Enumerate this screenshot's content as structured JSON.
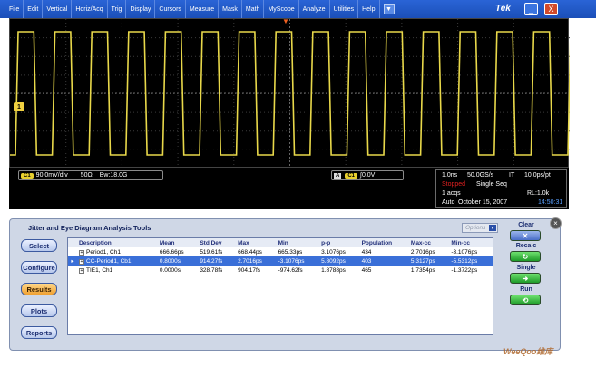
{
  "menubar": {
    "items": [
      "File",
      "Edit",
      "Vertical",
      "Horiz/Acq",
      "Trig",
      "Display",
      "Cursors",
      "Measure",
      "Mask",
      "Math",
      "MyScope",
      "Analyze",
      "Utilities",
      "Help"
    ],
    "logo": "Tek",
    "minimize_label": "_",
    "close_label": "X"
  },
  "waveform": {
    "channel_marker": "1",
    "color": "#e8d84a"
  },
  "readout": {
    "channel": {
      "badge": "C1",
      "scale": "90.0mV/div",
      "impedance": "50Ω",
      "bandwidth": "Bw:18.0G"
    },
    "trigger": {
      "source_a": "A",
      "badge": "C1",
      "level": "0.0V"
    },
    "acq": {
      "timebase": "1.0ns",
      "sample_rate": "50.0GS/s",
      "mode": "IT",
      "resolution": "10.0ps/pt",
      "state": "Stopped",
      "seq": "Single Seq",
      "acqs": "1 acqs",
      "record_length": "RL:1.0k",
      "trigger_mode": "Auto",
      "date": "October 15, 2007",
      "time": "14:50:31"
    }
  },
  "jitter_panel": {
    "title": "Jitter and Eye Diagram Analysis Tools",
    "options_label": "Options",
    "side_buttons": [
      "Select",
      "Configure",
      "Results",
      "Plots",
      "Reports"
    ],
    "active_button": "Results",
    "table": {
      "headers": [
        "Description",
        "Mean",
        "Std Dev",
        "Max",
        "Min",
        "p-p",
        "Population",
        "Max-cc",
        "Min-cc"
      ],
      "rows": [
        [
          "Period1, Ch1",
          "666.66ps",
          "519.61fs",
          "668.44ps",
          "665.33ps",
          "3.1076ps",
          "434",
          "2.7016ps",
          "-3.1076ps"
        ],
        [
          "CC-Period1, Cb1",
          "0.8000s",
          "914.27fs",
          "2.7016ps",
          "-3.1076ps",
          "5.8092ps",
          "403",
          "5.3127ps",
          "-5.5312ps"
        ],
        [
          "TIE1, Ch1",
          "0.0000s",
          "328.78fs",
          "904.17fs",
          "-974.62fs",
          "1.8788ps",
          "465",
          "1.7354ps",
          "-1.3722ps"
        ]
      ],
      "selected_row": 1,
      "selected_marker": "▸"
    },
    "controls": {
      "clear_label": "Clear",
      "recalc_label": "Recalc",
      "single_label": "Single",
      "run_label": "Run"
    },
    "close_label": "×"
  },
  "watermark": "WeeQoo维库"
}
